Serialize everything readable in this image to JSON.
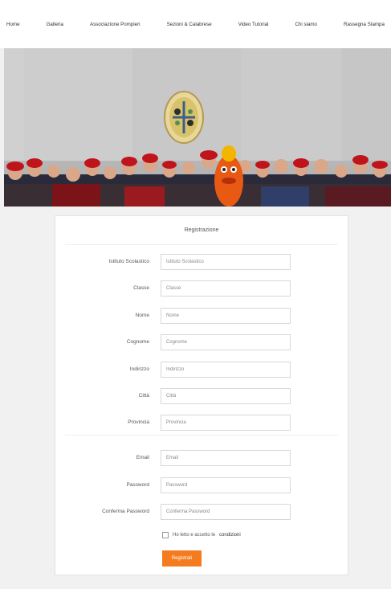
{
  "nav": {
    "items": [
      "Home",
      "Galleria",
      "Associazione Pompieri",
      "Sezioni & Calabrese",
      "Video Tutorial",
      "Chi siamo",
      "Rassegna Stampa"
    ]
  },
  "hero": {
    "image_name": "group-photo"
  },
  "form": {
    "title": "Registrazione",
    "fields": [
      {
        "label": "Istituto Scolastico",
        "placeholder": "Istituto Scolastico"
      },
      {
        "label": "Classe",
        "placeholder": "Classe"
      },
      {
        "label": "Nome",
        "placeholder": "Nome"
      },
      {
        "label": "Cognome",
        "placeholder": "Cognome"
      },
      {
        "label": "Indirizzo",
        "placeholder": "Indirizzo"
      },
      {
        "label": "Città",
        "placeholder": "Città"
      },
      {
        "label": "Provincia",
        "placeholder": "Provincia"
      },
      {
        "label": "Email",
        "placeholder": "Email"
      },
      {
        "label": "Password",
        "placeholder": "Password"
      },
      {
        "label": "Conferma Password",
        "placeholder": "Conferma Password"
      }
    ],
    "agree_text": "Ho letto e accetto le",
    "agree_link": "condizioni",
    "submit_label": "Registrati"
  },
  "colors": {
    "accent": "#f47b20",
    "hat_red": "#c0141c"
  }
}
